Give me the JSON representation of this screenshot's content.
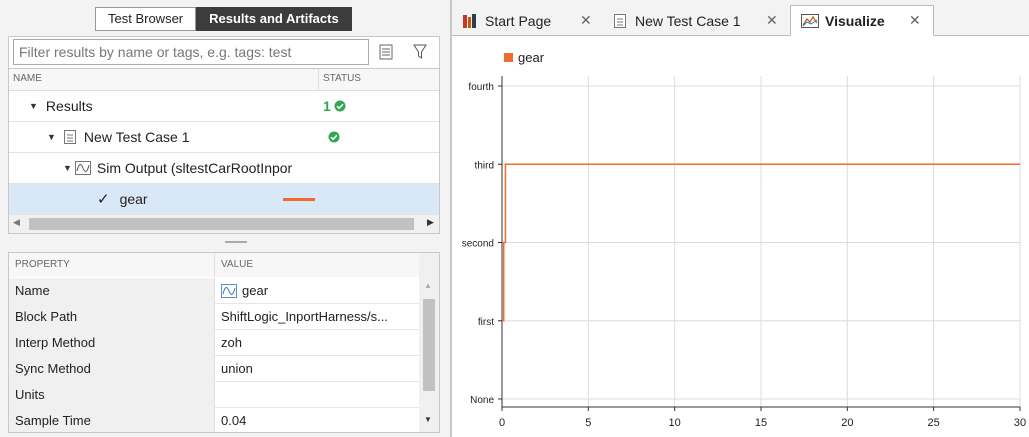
{
  "left_tabs": [
    "Test Browser",
    "Results and Artifacts"
  ],
  "filter": {
    "placeholder": "Filter results by name or tags, e.g. tags: test"
  },
  "tree": {
    "headers": {
      "name": "NAME",
      "status": "STATUS"
    },
    "rows": [
      {
        "label": "Results",
        "status": "1"
      },
      {
        "label": "New Test Case 1"
      },
      {
        "label": "Sim Output (sltestCarRootInpor"
      },
      {
        "label": "gear"
      }
    ]
  },
  "properties": {
    "headers": {
      "name": "PROPERTY",
      "value": "VALUE"
    },
    "rows": [
      {
        "name": "Name",
        "value": "gear"
      },
      {
        "name": "Block Path",
        "value": "ShiftLogic_InportHarness/s..."
      },
      {
        "name": "Interp Method",
        "value": "zoh"
      },
      {
        "name": "Sync Method",
        "value": "union"
      },
      {
        "name": "Units",
        "value": ""
      },
      {
        "name": "Sample Time",
        "value": "0.04"
      }
    ]
  },
  "doc_tabs": [
    {
      "label": "Start Page"
    },
    {
      "label": "New Test Case 1"
    },
    {
      "label": "Visualize"
    }
  ],
  "colors": {
    "accent": "#f26b2e",
    "pass": "#2fa84f",
    "selected_row": "#d9e8f7"
  },
  "chart_data": {
    "type": "line",
    "legend": [
      "gear"
    ],
    "legend_position": "top-left",
    "grid": true,
    "xlim": [
      0,
      30
    ],
    "x_ticks": [
      0,
      5,
      10,
      15,
      20,
      25,
      30
    ],
    "y_categories": [
      "None",
      "first",
      "second",
      "third",
      "fourth"
    ],
    "series": [
      {
        "name": "gear",
        "color": "#f26b2e",
        "points": [
          [
            0,
            1
          ],
          [
            0.1,
            2
          ],
          [
            0.2,
            3
          ],
          [
            30,
            3
          ]
        ]
      }
    ]
  }
}
